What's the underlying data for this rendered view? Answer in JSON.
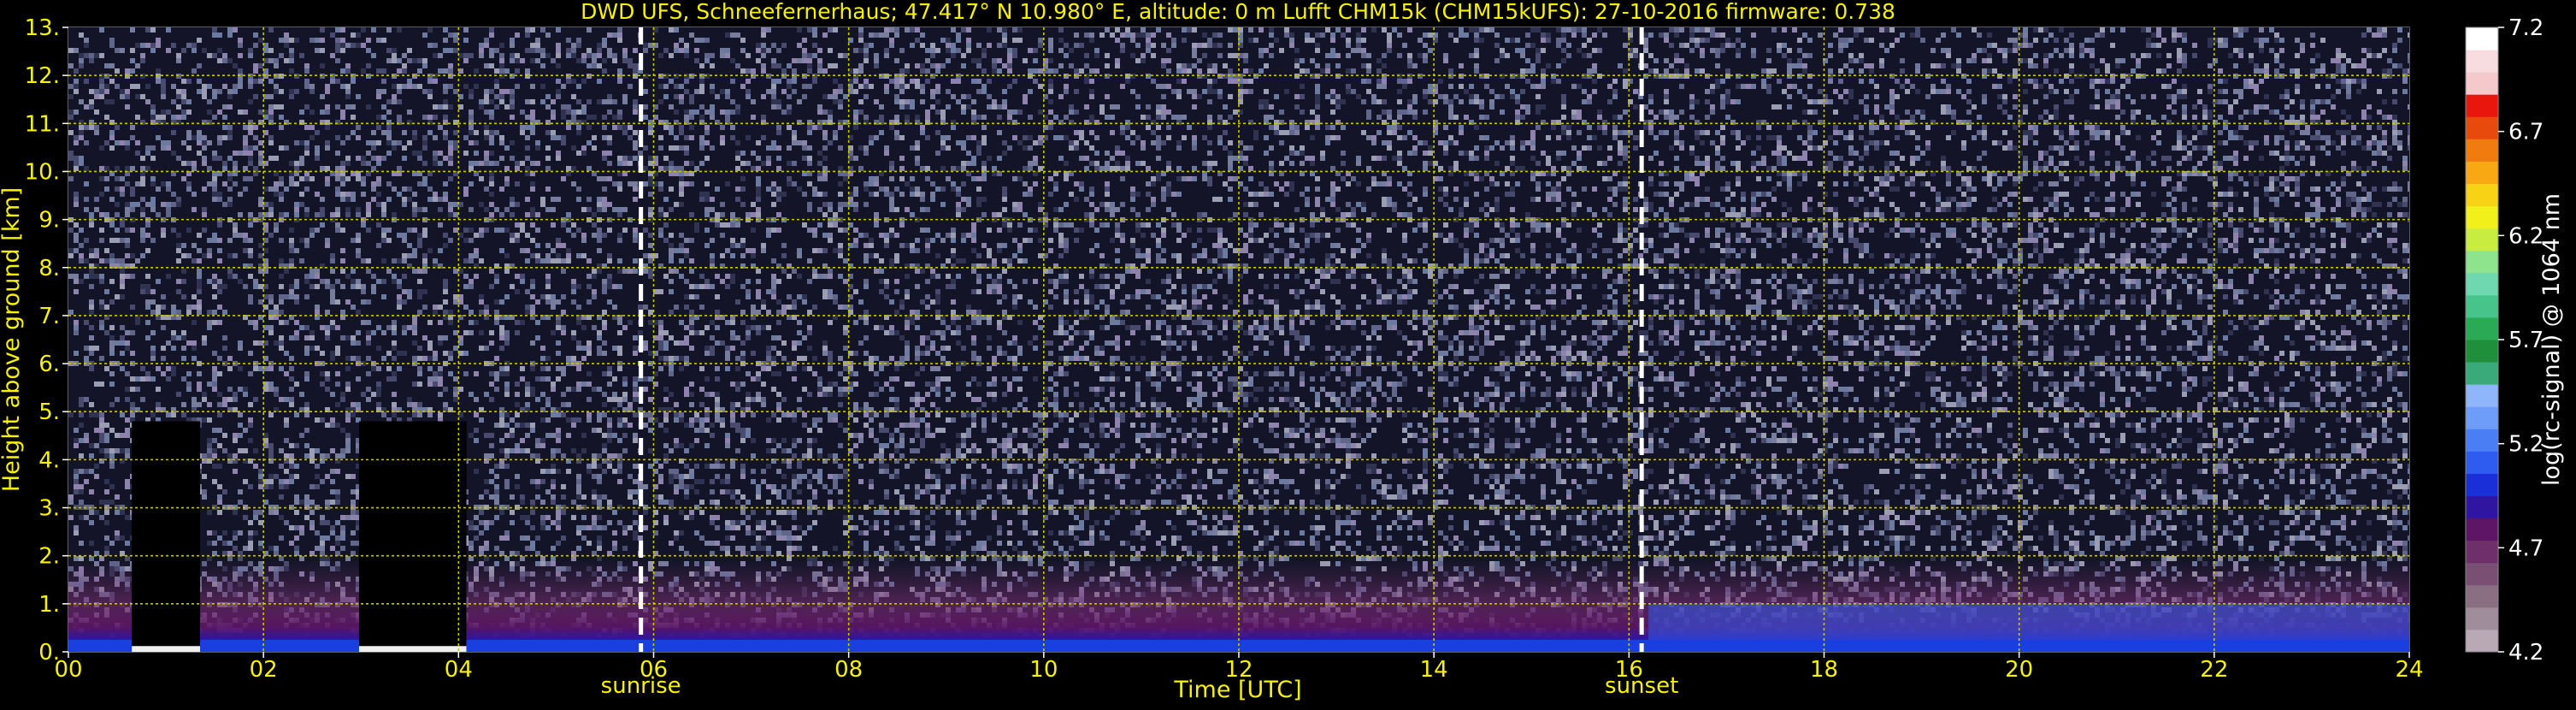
{
  "chart_data": {
    "type": "heatmap",
    "title": "DWD UFS, Schneefernerhaus; 47.417° N 10.980° E, altitude: 0 m    Lufft CHM15k (CHM15kUFS): 27-10-2016    firmware: 0.738",
    "xlabel": "Time [UTC]",
    "ylabel": "Height above ground [km]",
    "xlim": [
      0,
      24
    ],
    "ylim": [
      0,
      13
    ],
    "x_ticks": [
      "00",
      "02",
      "04",
      "06",
      "08",
      "10",
      "12",
      "14",
      "16",
      "18",
      "20",
      "22",
      "24"
    ],
    "y_ticks": [
      "0.",
      "1.",
      "2.",
      "3.",
      "4.",
      "5.",
      "6.",
      "7.",
      "8.",
      "9.",
      "10.",
      "11.",
      "12.",
      "13."
    ],
    "grid": true,
    "annotations": [
      {
        "label": "sunrise",
        "x": 5.87
      },
      {
        "label": "sunset",
        "x": 16.13
      }
    ],
    "colorbar": {
      "label": "log(rc-signal) @ 1064 nm",
      "range": [
        4.2,
        7.2
      ],
      "ticks": [
        "4.2",
        "4.7",
        "5.2",
        "5.7",
        "6.2",
        "6.7",
        "7.2"
      ],
      "colors": [
        "#b8a9b4",
        "#a08d9c",
        "#8a6e82",
        "#7a4f74",
        "#6e2f6a",
        "#5e1565",
        "#2f15a0",
        "#1a2fd8",
        "#2f5cf0",
        "#4a7ef5",
        "#6d9df8",
        "#8fb6fa",
        "#3aaa7a",
        "#1f8f3c",
        "#2aaa55",
        "#46c48a",
        "#6fd8b0",
        "#8ee48c",
        "#c8ec40",
        "#f2f01a",
        "#f8d214",
        "#f8a812",
        "#f07c10",
        "#e84a0e",
        "#e8160c",
        "#f5c8cc",
        "#f8dde0",
        "#ffffff"
      ]
    },
    "data_gaps": [
      [
        0.65,
        1.35
      ],
      [
        2.98,
        4.08
      ]
    ]
  }
}
